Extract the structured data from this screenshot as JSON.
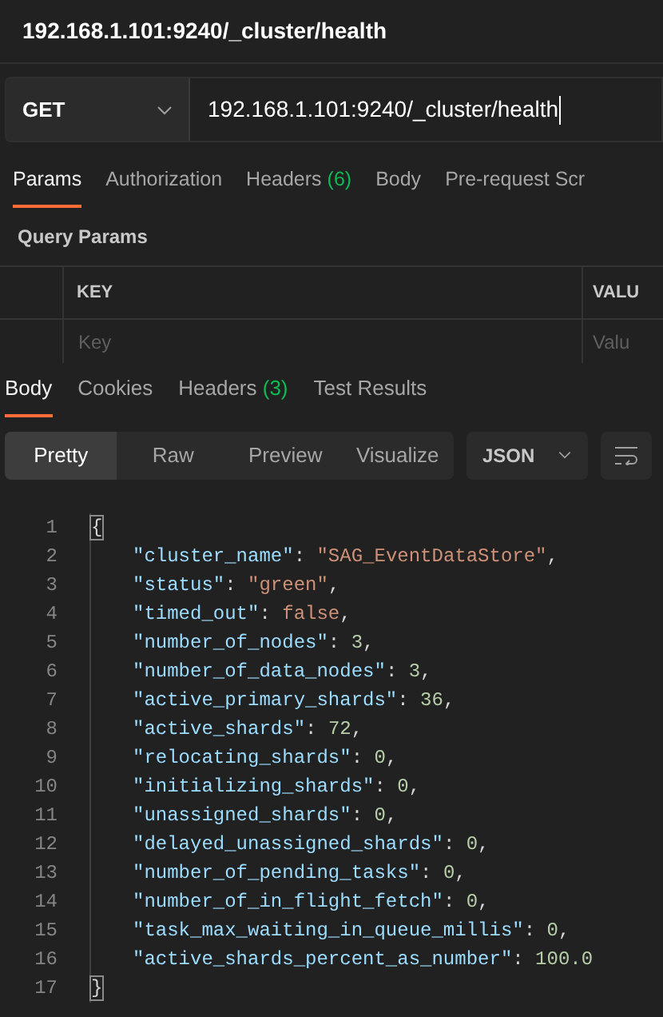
{
  "window": {
    "title": "192.168.1.101:9240/_cluster/health"
  },
  "request": {
    "method": "GET",
    "url": "192.168.1.101:9240/_cluster/health"
  },
  "request_tabs": [
    {
      "label": "Params",
      "selected": true
    },
    {
      "label": "Authorization",
      "selected": false
    },
    {
      "label": "Headers",
      "count": "(6)",
      "selected": false
    },
    {
      "label": "Body",
      "selected": false
    },
    {
      "label": "Pre-request Scr",
      "selected": false
    }
  ],
  "query_params": {
    "title": "Query Params",
    "columns": [
      "KEY",
      "VALU"
    ],
    "placeholders": [
      "Key",
      "Valu"
    ]
  },
  "response_tabs": [
    {
      "label": "Body",
      "selected": true
    },
    {
      "label": "Cookies",
      "selected": false
    },
    {
      "label": "Headers",
      "count": "(3)",
      "selected": false
    },
    {
      "label": "Test Results",
      "selected": false
    }
  ],
  "view_modes": [
    {
      "label": "Pretty",
      "selected": true
    },
    {
      "label": "Raw",
      "selected": false
    },
    {
      "label": "Preview",
      "selected": false
    },
    {
      "label": "Visualize",
      "selected": false
    }
  ],
  "format": "JSON",
  "code": [
    {
      "number": "1",
      "tokens": [
        {
          "kind": "bracket",
          "text": "{"
        }
      ],
      "children": [
        {
          "number": "2",
          "tokens": [
            {
              "kind": "key",
              "text": "\"cluster_name\""
            },
            {
              "kind": "punct",
              "text": ": "
            },
            {
              "kind": "string",
              "text": "\"SAG_EventDataStore\""
            },
            {
              "kind": "punct",
              "text": ","
            }
          ]
        },
        {
          "number": "3",
          "tokens": [
            {
              "kind": "key",
              "text": "\"status\""
            },
            {
              "kind": "punct",
              "text": ": "
            },
            {
              "kind": "string",
              "text": "\"green\""
            },
            {
              "kind": "punct",
              "text": ","
            }
          ]
        },
        {
          "number": "4",
          "tokens": [
            {
              "kind": "key",
              "text": "\"timed_out\""
            },
            {
              "kind": "punct",
              "text": ": "
            },
            {
              "kind": "boolean",
              "text": "false"
            },
            {
              "kind": "punct",
              "text": ","
            }
          ]
        },
        {
          "number": "5",
          "tokens": [
            {
              "kind": "key",
              "text": "\"number_of_nodes\""
            },
            {
              "kind": "punct",
              "text": ": "
            },
            {
              "kind": "number",
              "text": "3"
            },
            {
              "kind": "punct",
              "text": ","
            }
          ]
        },
        {
          "number": "6",
          "tokens": [
            {
              "kind": "key",
              "text": "\"number_of_data_nodes\""
            },
            {
              "kind": "punct",
              "text": ": "
            },
            {
              "kind": "number",
              "text": "3"
            },
            {
              "kind": "punct",
              "text": ","
            }
          ]
        },
        {
          "number": "7",
          "tokens": [
            {
              "kind": "key",
              "text": "\"active_primary_shards\""
            },
            {
              "kind": "punct",
              "text": ": "
            },
            {
              "kind": "number",
              "text": "36"
            },
            {
              "kind": "punct",
              "text": ","
            }
          ]
        },
        {
          "number": "8",
          "tokens": [
            {
              "kind": "key",
              "text": "\"active_shards\""
            },
            {
              "kind": "punct",
              "text": ": "
            },
            {
              "kind": "number",
              "text": "72"
            },
            {
              "kind": "punct",
              "text": ","
            }
          ]
        },
        {
          "number": "9",
          "tokens": [
            {
              "kind": "key",
              "text": "\"relocating_shards\""
            },
            {
              "kind": "punct",
              "text": ": "
            },
            {
              "kind": "number",
              "text": "0"
            },
            {
              "kind": "punct",
              "text": ","
            }
          ]
        },
        {
          "number": "10",
          "tokens": [
            {
              "kind": "key",
              "text": "\"initializing_shards\""
            },
            {
              "kind": "punct",
              "text": ": "
            },
            {
              "kind": "number",
              "text": "0"
            },
            {
              "kind": "punct",
              "text": ","
            }
          ]
        },
        {
          "number": "11",
          "tokens": [
            {
              "kind": "key",
              "text": "\"unassigned_shards\""
            },
            {
              "kind": "punct",
              "text": ": "
            },
            {
              "kind": "number",
              "text": "0"
            },
            {
              "kind": "punct",
              "text": ","
            }
          ]
        },
        {
          "number": "12",
          "tokens": [
            {
              "kind": "key",
              "text": "\"delayed_unassigned_shards\""
            },
            {
              "kind": "punct",
              "text": ": "
            },
            {
              "kind": "number",
              "text": "0"
            },
            {
              "kind": "punct",
              "text": ","
            }
          ]
        },
        {
          "number": "13",
          "tokens": [
            {
              "kind": "key",
              "text": "\"number_of_pending_tasks\""
            },
            {
              "kind": "punct",
              "text": ": "
            },
            {
              "kind": "number",
              "text": "0"
            },
            {
              "kind": "punct",
              "text": ","
            }
          ]
        },
        {
          "number": "14",
          "tokens": [
            {
              "kind": "key",
              "text": "\"number_of_in_flight_fetch\""
            },
            {
              "kind": "punct",
              "text": ": "
            },
            {
              "kind": "number",
              "text": "0"
            },
            {
              "kind": "punct",
              "text": ","
            }
          ]
        },
        {
          "number": "15",
          "tokens": [
            {
              "kind": "key",
              "text": "\"task_max_waiting_in_queue_millis\""
            },
            {
              "kind": "punct",
              "text": ": "
            },
            {
              "kind": "number",
              "text": "0"
            },
            {
              "kind": "punct",
              "text": ","
            }
          ]
        },
        {
          "number": "16",
          "tokens": [
            {
              "kind": "key",
              "text": "\"active_shards_percent_as_number\""
            },
            {
              "kind": "punct",
              "text": ": "
            },
            {
              "kind": "number",
              "text": "100.0"
            }
          ]
        }
      ]
    },
    {
      "number": "17",
      "tokens": [
        {
          "kind": "bracket",
          "text": "}"
        }
      ]
    }
  ]
}
